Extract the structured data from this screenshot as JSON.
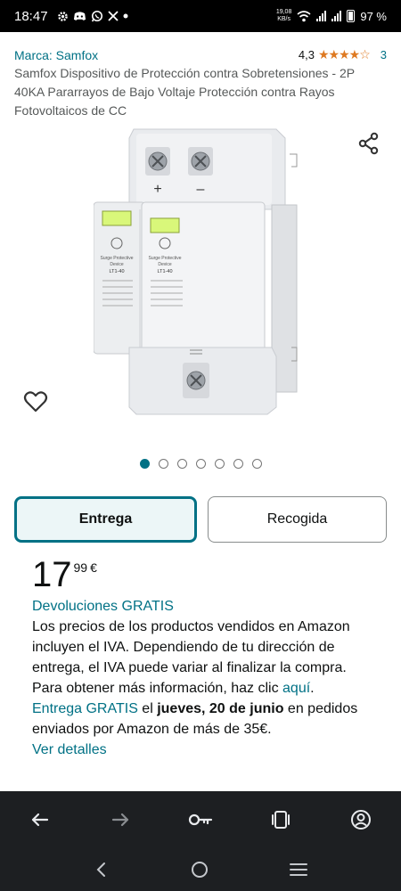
{
  "status_bar": {
    "time": "18:47",
    "net_speed_value": "19,08",
    "net_speed_unit": "KB/s",
    "battery": "97 %",
    "notification_icons": [
      "gear-icon",
      "discord-icon",
      "whatsapp-icon",
      "x-icon",
      "dot-icon"
    ]
  },
  "product": {
    "brand": "Marca: Samfox",
    "rating_value": "4,3",
    "stars": "★★★★☆",
    "rating_count": "3",
    "title": "Samfox Dispositivo de Protección contra Sobretensiones - 2P 40KA Pararrayos de Bajo Voltaje Protección contra Rayos Fotovoltaicos de CC",
    "image_label_text": "Surge Protective Device",
    "image_model": "LT1-40"
  },
  "carousel": {
    "total": 7,
    "active_index": 0
  },
  "delivery_toggle": {
    "delivery_label": "Entrega",
    "pickup_label": "Recogida",
    "selected": "Entrega"
  },
  "price": {
    "whole": "17",
    "fraction": "99",
    "currency": "€"
  },
  "info": {
    "returns_link": "Devoluciones GRATIS",
    "vat_text": "Los precios de los productos vendidos en Amazon incluyen el IVA. Dependiendo de tu dirección de entrega, el IVA puede variar al finalizar la compra. Para obtener más información, haz clic",
    "here_link": "aquí",
    "dot": ".",
    "free_delivery_link": "Entrega GRATIS",
    "delivery_prefix": " el ",
    "delivery_date": "jueves, 20 de junio",
    "delivery_suffix": " en pedidos enviados por Amazon de más de 35€.",
    "details_link": "Ver detalles"
  },
  "colors": {
    "link": "#007185",
    "star": "#de7921",
    "selected_border": "#007185",
    "selected_bg": "#ecf6f7",
    "nav_bg": "#1d1f22"
  }
}
